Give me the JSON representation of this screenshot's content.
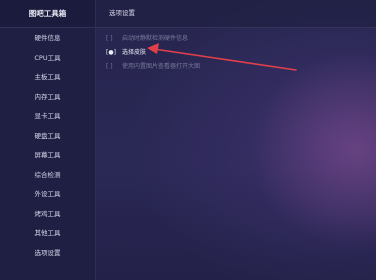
{
  "app": {
    "title": "图吧工具箱"
  },
  "sidebar": {
    "items": [
      {
        "label": "硬件信息"
      },
      {
        "label": "CPU工具"
      },
      {
        "label": "主板工具"
      },
      {
        "label": "内存工具"
      },
      {
        "label": "显卡工具"
      },
      {
        "label": "硬盘工具"
      },
      {
        "label": "屏幕工具"
      },
      {
        "label": "综合检测"
      },
      {
        "label": "外设工具"
      },
      {
        "label": "烤鸡工具"
      },
      {
        "label": "其他工具"
      },
      {
        "label": "选项设置"
      }
    ]
  },
  "main": {
    "header": "选项设置",
    "options": [
      {
        "box": "[  ]",
        "label": "启动时静默检测硬件信息",
        "checked": false
      },
      {
        "box": "[●]",
        "label": "选择皮肤",
        "checked": true
      },
      {
        "box": "[  ]",
        "label": "使用内置图片查看器打开大图",
        "checked": false
      }
    ]
  },
  "colors": {
    "sidebar_bg": "#1f1f44",
    "main_bg": "#26254e",
    "arrow": "#e0404a"
  }
}
